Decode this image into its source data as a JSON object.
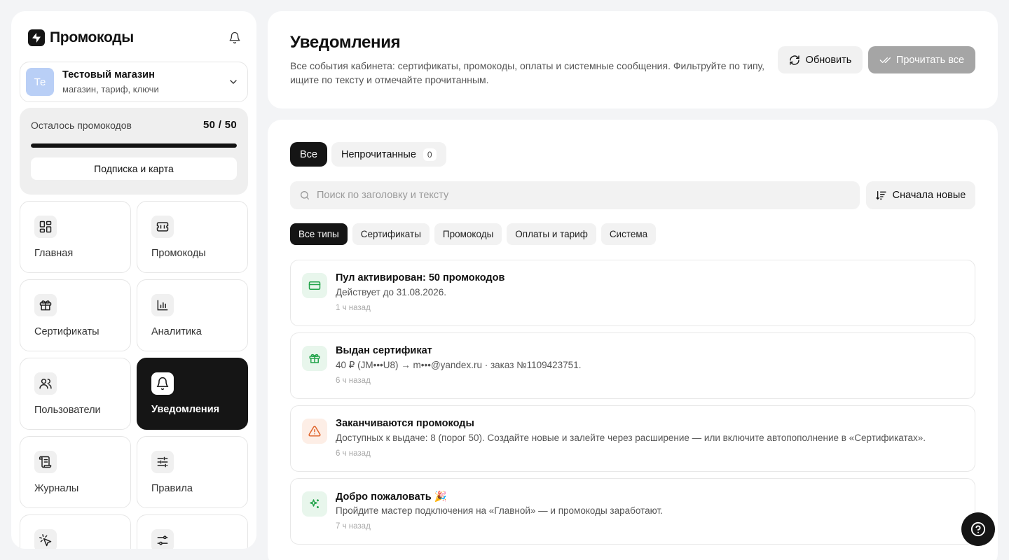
{
  "brand": {
    "name": "Промокоды"
  },
  "store": {
    "initials": "Те",
    "name": "Тестовый магазин",
    "subtitle": "магазин, тариф, ключи"
  },
  "quota": {
    "label": "Осталось промокодов",
    "value": "50 / 50",
    "fraction": 1.0,
    "button": "Подписка и карта"
  },
  "nav": [
    {
      "label": "Главная",
      "icon": "dashboard-icon"
    },
    {
      "label": "Промокоды",
      "icon": "ticket-icon"
    },
    {
      "label": "Сертификаты",
      "icon": "gift-icon"
    },
    {
      "label": "Аналитика",
      "icon": "chart-icon"
    },
    {
      "label": "Пользователи",
      "icon": "users-icon"
    },
    {
      "label": "Уведомления",
      "icon": "bell-icon",
      "active": true
    },
    {
      "label": "Журналы",
      "icon": "scroll-icon"
    },
    {
      "label": "Правила",
      "icon": "sliders-icon"
    },
    {
      "label": "",
      "icon": "pointer-click-icon"
    },
    {
      "label": "",
      "icon": "settings-icon"
    }
  ],
  "header": {
    "title": "Уведомления",
    "description": "Все события кабинета: сертификаты, промокоды, оплаты и системные сообщения. Фильтруйте по типу, ищите по тексту и отмечайте прочитанным.",
    "refresh_label": "Обновить",
    "read_all_label": "Прочитать все"
  },
  "tabs": {
    "all": "Все",
    "unread": "Непрочитанные",
    "unread_count": "0"
  },
  "search": {
    "placeholder": "Поиск по заголовку и тексту"
  },
  "sort": {
    "label": "Сначала новые"
  },
  "types": [
    "Все типы",
    "Сертификаты",
    "Промокоды",
    "Оплаты и тариф",
    "Система"
  ],
  "notifications": [
    {
      "title": "Пул активирован: 50 промокодов",
      "body": "Действует до 31.08.2026.",
      "time": "1 ч назад",
      "icon": "card-icon",
      "color": "#22a34a",
      "bg": "#e8f6ec"
    },
    {
      "title": "Выдан сертификат",
      "body": "40 ₽ (JM•••U8) → m•••@yandex.ru · заказ №1109423751.",
      "time": "6 ч назад",
      "icon": "gift-icon",
      "color": "#22a34a",
      "bg": "#e8f6ec"
    },
    {
      "title": "Заканчиваются промокоды",
      "body": "Доступных к выдаче: 8 (порог 50). Создайте новые и залейте через расширение — или включите автопополнение в «Сертификатах».",
      "time": "6 ч назад",
      "icon": "warning-icon",
      "color": "#e0652c",
      "bg": "#fdeee6"
    },
    {
      "title": "Добро пожаловать 🎉",
      "body": "Пройдите мастер подключения на «Главной» — и промокоды заработают.",
      "time": "7 ч назад",
      "icon": "sparkle-icon",
      "color": "#22a34a",
      "bg": "#e8f6ec"
    }
  ],
  "colors": {
    "accent": "#151515",
    "success": "#22a34a",
    "warning": "#e0652c",
    "avatar": "#b9cff6"
  }
}
